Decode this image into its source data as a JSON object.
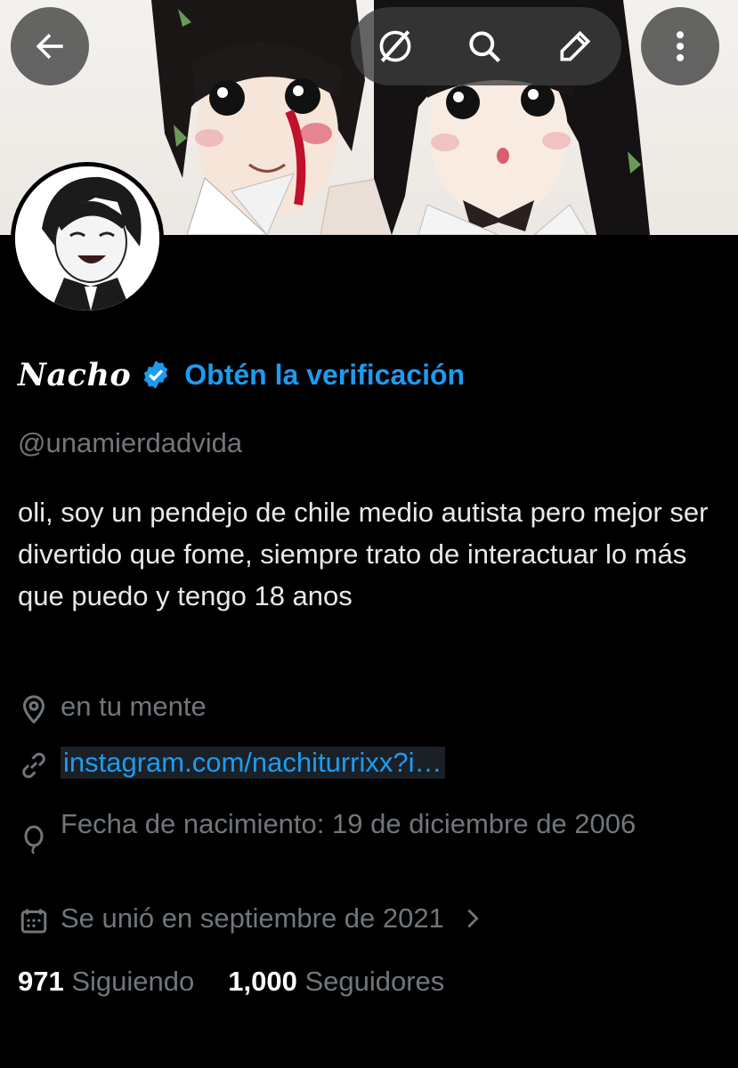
{
  "header": {
    "back_icon": "arrow-left-icon",
    "grok_icon": "grok-icon",
    "search_icon": "search-icon",
    "edit_icon": "pencil-icon",
    "more_icon": "more-vertical-icon"
  },
  "profile": {
    "display_name": "Nacho",
    "verify_label": "Obtén la verificación",
    "handle": "@unamierdadvida",
    "bio": "oli, soy un pendejo de chile medio autista pero mejor ser divertido que fome, siempre trato de interactuar lo más que puedo y tengo 18 anos",
    "location": "en tu mente",
    "website": "instagram.com/nachiturrixx?i…",
    "birthday": "Fecha de nacimiento: 19 de diciembre de 2006",
    "joined": "Se unió en septiembre de 2021",
    "following_count": "971",
    "following_label": "Siguiendo",
    "followers_count": "1,000",
    "followers_label": "Seguidores"
  },
  "colors": {
    "accent": "#1d9bf0",
    "secondary_text": "#71767b",
    "background": "#000000"
  }
}
